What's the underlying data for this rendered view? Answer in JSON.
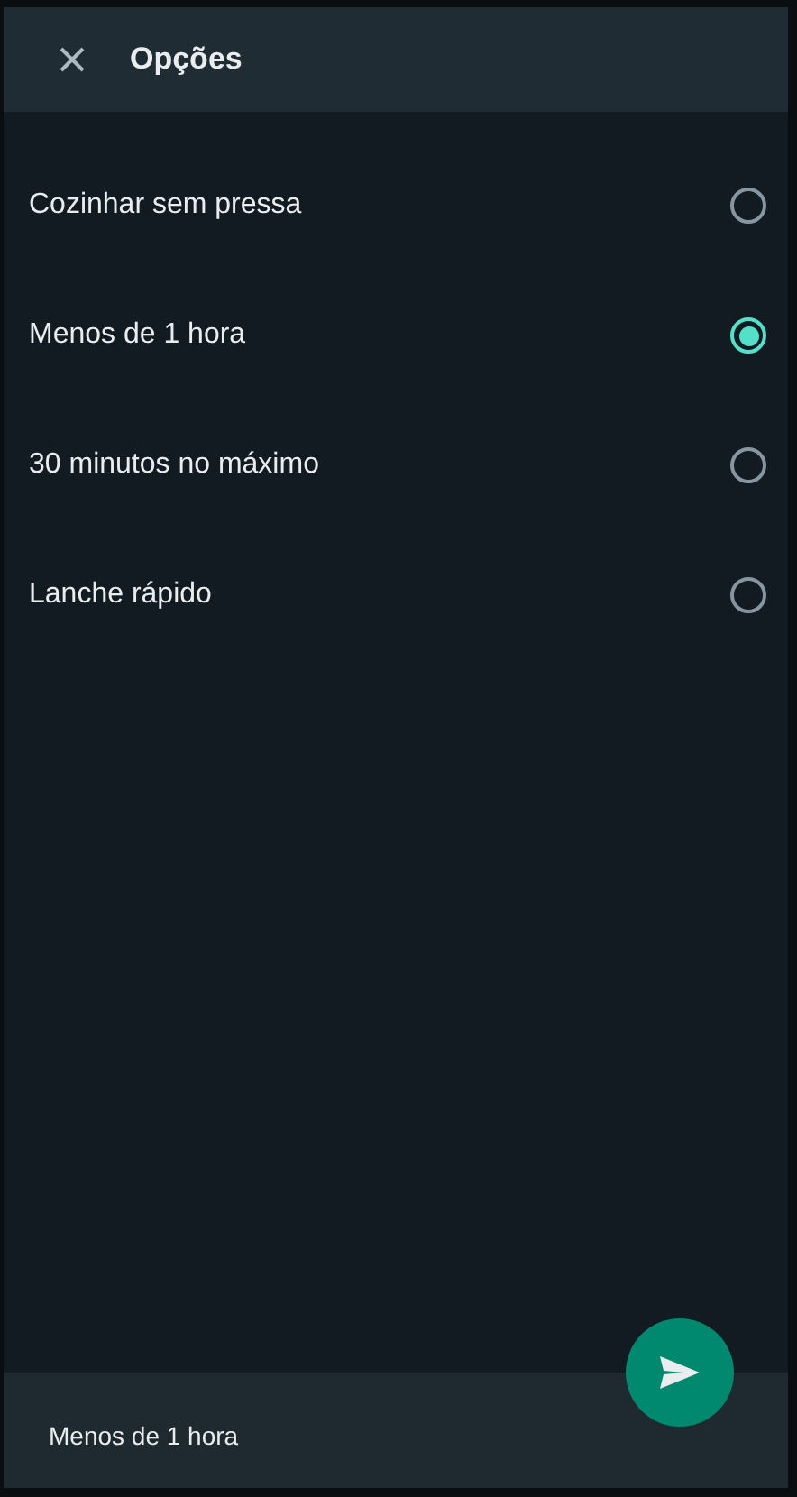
{
  "header": {
    "title": "Opções"
  },
  "options": [
    {
      "label": "Cozinhar sem pressa",
      "selected": false
    },
    {
      "label": "Menos de 1 hora",
      "selected": true
    },
    {
      "label": "30 minutos no máximo",
      "selected": false
    },
    {
      "label": "Lanche rápido",
      "selected": false
    }
  ],
  "footer": {
    "selection": "Menos de 1 hora"
  }
}
